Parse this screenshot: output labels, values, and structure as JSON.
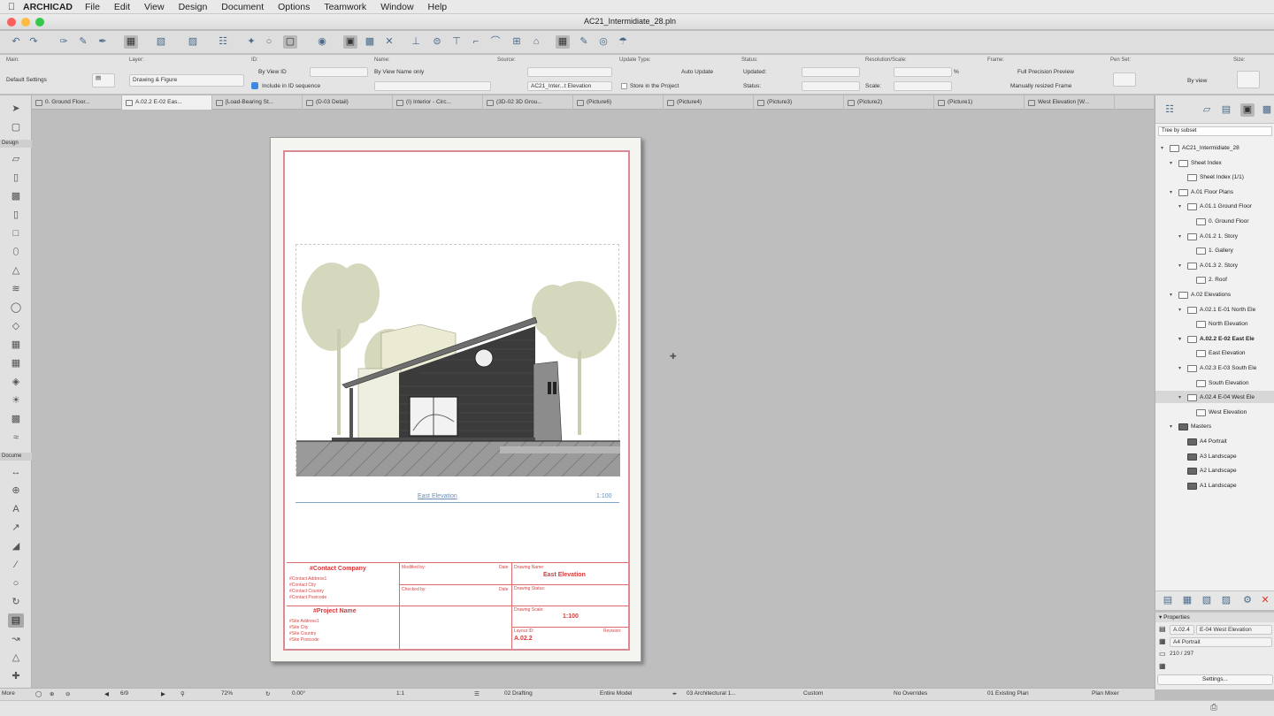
{
  "menubar": {
    "app_name": "ARCHICAD",
    "items": [
      "File",
      "Edit",
      "View",
      "Design",
      "Document",
      "Options",
      "Teamwork",
      "Window",
      "Help"
    ]
  },
  "window": {
    "title": "AC21_Intermidiate_28.pln"
  },
  "infobox": {
    "main_label": "Main:",
    "default_settings": "Default Settings",
    "layer_label": "Layer:",
    "layer_value": "Drawing & Figure",
    "id_label": "ID:",
    "id_by_view": "By View ID",
    "include_id": "Include in ID sequence",
    "name_label": "Name:",
    "name_value": "By View Name only",
    "source_label": "Source:",
    "source_value": "AC21_Inter...t Elevation",
    "update_label": "Update Type:",
    "update_value": "Auto Update",
    "store_project": "Store in the Project",
    "status_label": "Status:",
    "updated_label": "Updated:",
    "status2_label": "Status:",
    "resolution_label": "Resolution/Scale:",
    "percent": "%",
    "scale_label": "Scale:",
    "frame_label": "Frame:",
    "frame_preview": "Full Precision Preview",
    "frame_resize": "Manually resized Frame",
    "penset_label": "Pen Set:",
    "by_view": "By view",
    "size_label": "Size:"
  },
  "tabs": [
    {
      "label": "0. Ground Floor..."
    },
    {
      "label": "A.02.2 E-02 Eas..."
    },
    {
      "label": "[Load-Bearing St..."
    },
    {
      "label": "(D-03 Detail)"
    },
    {
      "label": "(I) Interior - Circ..."
    },
    {
      "label": "(3D-02 3D Grou..."
    },
    {
      "label": "(Picture6)"
    },
    {
      "label": "(Picture4)"
    },
    {
      "label": "(Picture3)"
    },
    {
      "label": "(Picture2)"
    },
    {
      "label": "(Picture1)"
    },
    {
      "label": "West Elevation [W..."
    }
  ],
  "toolbox": {
    "design_header": "Design",
    "document_header": "Docume",
    "more_label": "More"
  },
  "sheet": {
    "drawing_name": "East Elevation",
    "drawing_scale": "1:100",
    "titleblock": {
      "company": "#Contact Company",
      "company_lines": [
        "#Contact Address1",
        "#Contact City",
        "#Contact Country",
        "#Contact Postcode"
      ],
      "modified_by": "Modified by:",
      "date1": "Date",
      "checked_by": "Checked by:",
      "date2": "Date",
      "drawing_name_label": "Drawing Name:",
      "drawing_name_value": "East Elevation",
      "drawing_status_label": "Drawing Status:",
      "project_name": "#Project Name",
      "project_lines": [
        "#Site Address1",
        "#Site City",
        "#Site Country",
        "#Site Postcode"
      ],
      "drawing_scale_label": "Drawing Scale:",
      "drawing_scale_value": "1:100",
      "layout_id_label": "Layout ID:",
      "revision_label": "Revision:",
      "layout_id_value": "A.02.2"
    }
  },
  "navigator": {
    "view_select": "Tree by subset",
    "tree": [
      {
        "label": "AC21_Intermidiate_28",
        "level": 0,
        "icon": "book"
      },
      {
        "label": "Sheet Index",
        "level": 1,
        "icon": "folder"
      },
      {
        "label": "Sheet Index (1/1)",
        "level": 2,
        "icon": "sheet"
      },
      {
        "label": "A.01 Floor Plans",
        "level": 1,
        "icon": "folder"
      },
      {
        "label": "A.01.1 Ground Floor",
        "level": 2,
        "icon": "sheet"
      },
      {
        "label": "0. Ground Floor",
        "level": 3,
        "icon": "drawing"
      },
      {
        "label": "A.01.2 1. Story",
        "level": 2,
        "icon": "sheet"
      },
      {
        "label": "1. Gallery",
        "level": 3,
        "icon": "drawing"
      },
      {
        "label": "A.01.3 2. Story",
        "level": 2,
        "icon": "sheet"
      },
      {
        "label": "2. Roof",
        "level": 3,
        "icon": "drawing"
      },
      {
        "label": "A.02 Elevations",
        "level": 1,
        "icon": "folder"
      },
      {
        "label": "A.02.1 E-01 North Ele",
        "level": 2,
        "icon": "sheet"
      },
      {
        "label": "North Elevation",
        "level": 3,
        "icon": "drawing"
      },
      {
        "label": "A.02.2 E-02 East Ele",
        "level": 2,
        "icon": "sheet",
        "bold": true
      },
      {
        "label": "East Elevation",
        "level": 3,
        "icon": "drawing"
      },
      {
        "label": "A.02.3 E-03 South Ele",
        "level": 2,
        "icon": "sheet"
      },
      {
        "label": "South Elevation",
        "level": 3,
        "icon": "drawing"
      },
      {
        "label": "A.02.4 E-04 West Ele",
        "level": 2,
        "icon": "sheet",
        "selected": true
      },
      {
        "label": "West Elevation",
        "level": 3,
        "icon": "drawing"
      },
      {
        "label": "Masters",
        "level": 1,
        "icon": "folder-dark"
      },
      {
        "label": "A4 Portrait",
        "level": 2,
        "icon": "master"
      },
      {
        "label": "A3 Landscape",
        "level": 2,
        "icon": "master"
      },
      {
        "label": "A2 Landscape",
        "level": 2,
        "icon": "master"
      },
      {
        "label": "A1 Landscape",
        "level": 2,
        "icon": "master"
      }
    ]
  },
  "properties": {
    "header": "Properties",
    "id_value": "A.02.4",
    "name_value": "E-04 West Elevation",
    "master_value": "A4 Portrait",
    "size_value": "210 / 297",
    "settings_button": "Settings..."
  },
  "statusbar": {
    "page": "6/9",
    "zoom": "72%",
    "angle": "0.00°",
    "ratio": "1:1",
    "layer_combo": "02 Drafting",
    "model": "Entire Model",
    "pen": "03 Architectural 1...",
    "custom": "Custom",
    "override": "No Overrides",
    "renovation": "01 Existing Plan",
    "mode": "Plan Mixer"
  },
  "colors": {
    "accent": "#4a6a8a",
    "sheet_border": "#d98b95",
    "titleblock_red": "#d43b3b",
    "drawing_caption": "#6a8db3"
  }
}
